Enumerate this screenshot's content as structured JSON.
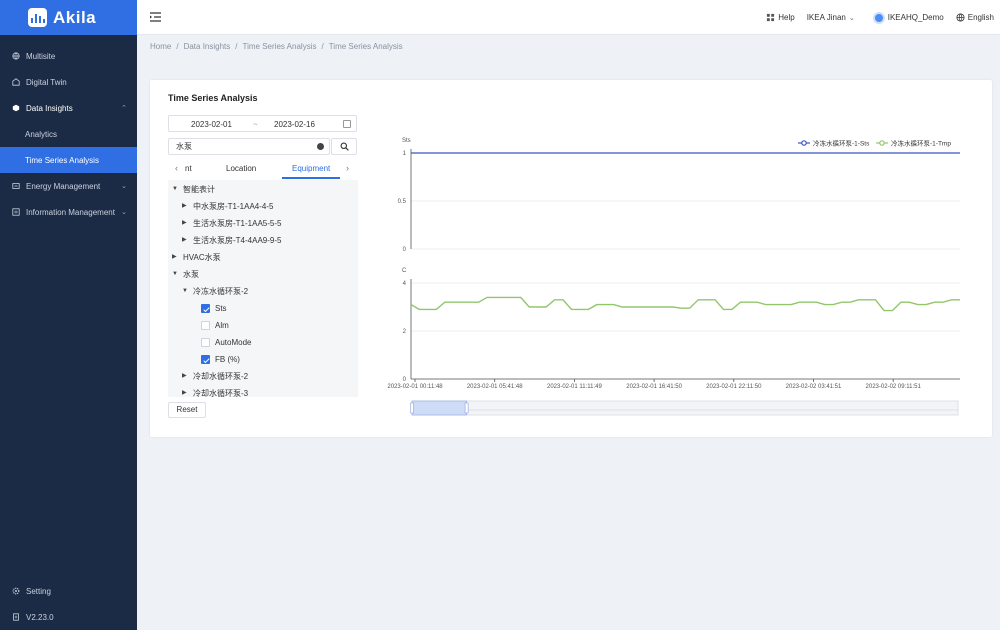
{
  "brand": {
    "name": "Akila"
  },
  "sidebar": {
    "items": [
      {
        "label": "Multisite",
        "icon": "globe-icon"
      },
      {
        "label": "Digital Twin",
        "icon": "building-icon"
      },
      {
        "label": "Data Insights",
        "icon": "cube-icon",
        "expanded": true
      },
      {
        "label": "Analytics",
        "sub": true
      },
      {
        "label": "Time Series Analysis",
        "sub": true,
        "active": true
      },
      {
        "label": "Energy Management",
        "icon": "energy-icon"
      },
      {
        "label": "Information Management",
        "icon": "info-icon"
      }
    ],
    "setting": "Setting",
    "version": "V2.23.0"
  },
  "topbar": {
    "help": "Help",
    "site": "IKEA Jinan",
    "user": "IKEAHQ_Demo",
    "language": "English"
  },
  "breadcrumb": [
    "Home",
    "Data Insights",
    "Time Series Analysis",
    "Time Series Analysis"
  ],
  "page": {
    "title": "Time Series Analysis",
    "date_start": "2023-02-01",
    "date_sep": "~",
    "date_end": "2023-02-16",
    "search_value": "水泵",
    "tabs": [
      "nt",
      "Location",
      "Equipment"
    ],
    "active_tab": "Equipment",
    "reset": "Reset"
  },
  "tree": [
    {
      "label": "智能表计",
      "level": 0,
      "expanded": true
    },
    {
      "label": "中水泵房-T1-1AA4-4-5",
      "level": 1
    },
    {
      "label": "生活水泵房-T1-1AA5-5-5",
      "level": 1
    },
    {
      "label": "生活水泵房-T4-4AA9-9-5",
      "level": 1
    },
    {
      "label": "HVAC水泵",
      "level": 0
    },
    {
      "label": "水泵",
      "level": 0,
      "expanded": true
    },
    {
      "label": "冷冻水循环泵-2",
      "level": 1,
      "expanded": true
    },
    {
      "label": "Sts",
      "level": 2,
      "checked": true
    },
    {
      "label": "Alm",
      "level": 2,
      "checked": false
    },
    {
      "label": "AutoMode",
      "level": 2,
      "checked": false
    },
    {
      "label": "FB (%)",
      "level": 2,
      "checked": true
    },
    {
      "label": "冷却水循环泵-2",
      "level": 1
    },
    {
      "label": "冷却水循环泵-3",
      "level": 1
    }
  ],
  "chart_data": {
    "type": "line",
    "legend": [
      "冷冻水循环泵-1-Sts",
      "冷冻水循环泵-1-Tmp"
    ],
    "colors": {
      "sts": "#3b55c5",
      "tmp": "#92c66c"
    },
    "x_ticks": [
      "2023-02-01 00:11:48",
      "2023-02-01 05:41:48",
      "2023-02-01 11:11:49",
      "2023-02-01 16:41:50",
      "2023-02-01 22:11:50",
      "2023-02-02 03:41:51",
      "2023-02-02 09:11:51"
    ],
    "panels": [
      {
        "ylabel": "Sts",
        "yticks": [
          "1",
          "0.5",
          "0"
        ],
        "ylim": [
          0,
          1
        ],
        "series": "冷冻水循环泵-1-Sts",
        "values": [
          1,
          1,
          1,
          1,
          1,
          1,
          1,
          1,
          1,
          1,
          1,
          1,
          1,
          1,
          1,
          1,
          1,
          1,
          1,
          1,
          1,
          1,
          1,
          1,
          1,
          1,
          1,
          1,
          1,
          1,
          1,
          1,
          1,
          1,
          1,
          1,
          1,
          1,
          1,
          1,
          1,
          1,
          1,
          1,
          1,
          1,
          1,
          1,
          1,
          1,
          1,
          1,
          1,
          1,
          1,
          1,
          1,
          1,
          1,
          1
        ]
      },
      {
        "ylabel": "C",
        "yticks": [
          "4",
          "2",
          "0"
        ],
        "ylim": [
          0,
          4
        ],
        "series": "冷冻水循环泵-1-Tmp",
        "values": [
          3.1,
          2.9,
          2.9,
          2.9,
          3.2,
          3.2,
          3.2,
          3.2,
          3.2,
          3.4,
          3.4,
          3.4,
          3.4,
          3.4,
          3.0,
          3.0,
          3.0,
          3.3,
          3.3,
          2.9,
          2.9,
          2.9,
          3.1,
          3.1,
          3.1,
          3.0,
          3.0,
          3.0,
          3.0,
          3.0,
          3.0,
          3.0,
          2.95,
          2.95,
          3.3,
          3.3,
          3.3,
          2.9,
          2.9,
          3.2,
          3.2,
          3.2,
          3.1,
          3.1,
          3.1,
          3.1,
          3.2,
          3.2,
          3.2,
          3.1,
          3.1,
          3.2,
          3.2,
          3.3,
          3.3,
          3.3,
          2.85,
          2.85,
          3.2,
          3.2,
          3.1,
          3.1,
          3.2,
          3.2,
          3.3,
          3.3
        ]
      }
    ],
    "zoom_range": [
      0,
      0.1
    ]
  }
}
